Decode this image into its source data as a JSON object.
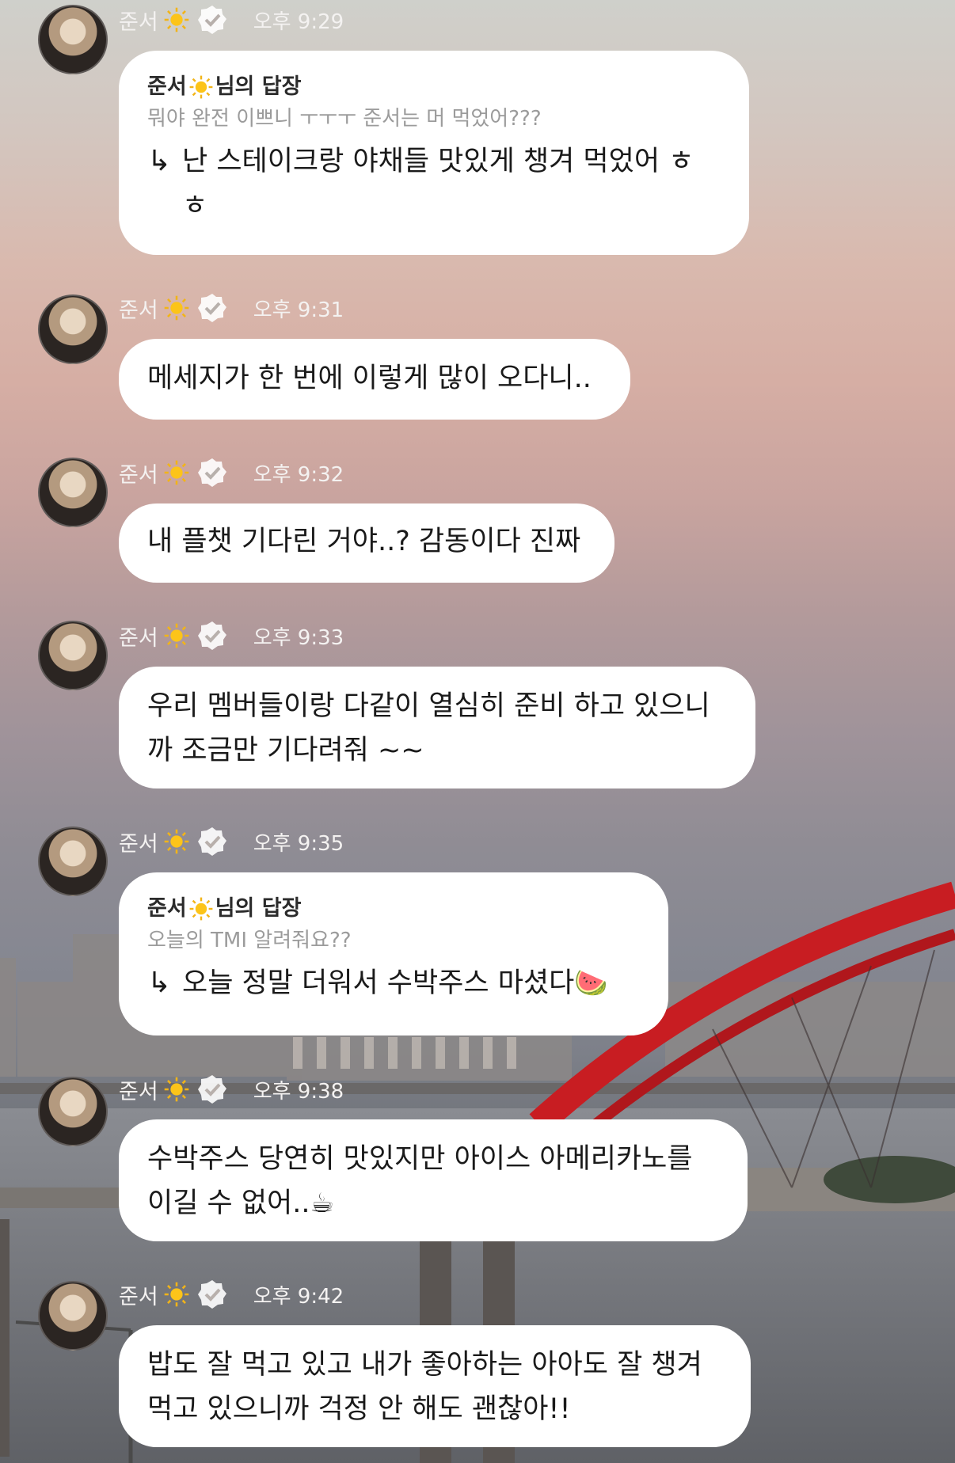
{
  "colors": {
    "bubble": "#ffffff",
    "meta_text": "#f4f2f1",
    "bridge_red": "#c81d22"
  },
  "messages": [
    {
      "name": "준서",
      "time": "오후 9:29",
      "reply": {
        "head_name": "준서",
        "head_suffix": "님의 답장",
        "question": "뭐야 완전 이쁘니 ㅜㅜㅜ 준서는 머 먹었어???",
        "answer": "난 스테이크랑 야채들 맛있게 챙겨 먹었어 ㅎ\nㅎ"
      }
    },
    {
      "name": "준서",
      "time": "오후 9:31",
      "text": "메세지가 한 번에 이렇게 많이 오다니.."
    },
    {
      "name": "준서",
      "time": "오후 9:32",
      "text": "내 플챗 기다린 거야..? 감동이다 진짜"
    },
    {
      "name": "준서",
      "time": "오후 9:33",
      "text": "우리 멤버들이랑 다같이 열심히 준비 하고 있으니\n까 조금만 기다려줘 ~~"
    },
    {
      "name": "준서",
      "time": "오후 9:35",
      "reply": {
        "head_name": "준서",
        "head_suffix": "님의 답장",
        "question": "오늘의 TMI 알려줘요??",
        "answer": "오늘 정말 더워서 수박주스 마셨다",
        "emoji": "🍉"
      }
    },
    {
      "name": "준서",
      "time": "오후 9:38",
      "text": "수박주스 당연히 맛있지만 아이스 아메리카노를\n이길 수 없어..",
      "emoji": "☕"
    },
    {
      "name": "준서",
      "time": "오후 9:42",
      "text": "밥도 잘 먹고 있고 내가 좋아하는 아아도 잘 챙겨\n먹고 있으니까 걱정 안 해도 괜찮아!!"
    }
  ],
  "icons": {
    "sun": "sun-icon",
    "verified": "verified-badge-icon",
    "reply_arrow": "reply-arrow-icon"
  }
}
